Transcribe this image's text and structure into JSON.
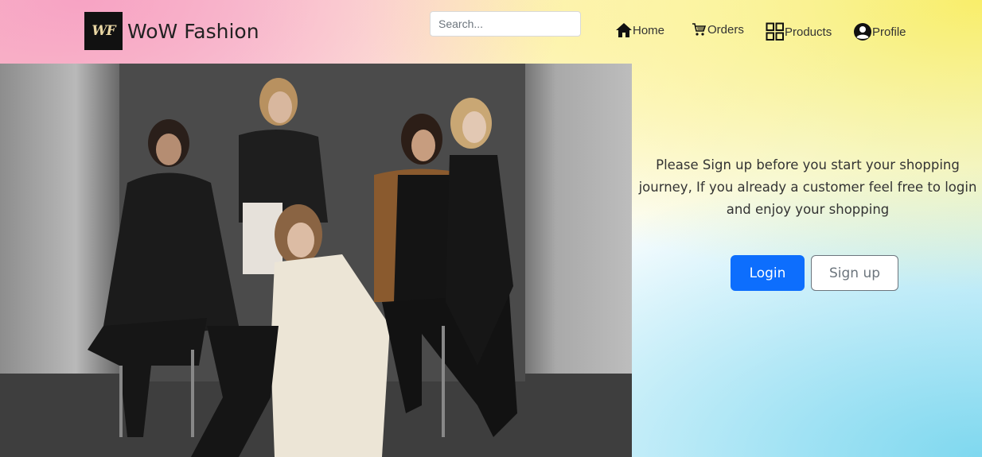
{
  "brand": {
    "logo_text": "WF",
    "name": "WoW Fashion"
  },
  "search": {
    "placeholder": "Search...",
    "value": ""
  },
  "nav": {
    "home": "Home",
    "orders": "Orders",
    "products": "Products",
    "profile": "Profile"
  },
  "hero": {
    "message": "Please Sign up before you start your shopping journey, If you already a customer feel free to login and enjoy your shopping"
  },
  "buttons": {
    "login": "Login",
    "signup": "Sign up"
  },
  "colors": {
    "primary": "#0d6efd",
    "secondary": "#6c757d"
  }
}
